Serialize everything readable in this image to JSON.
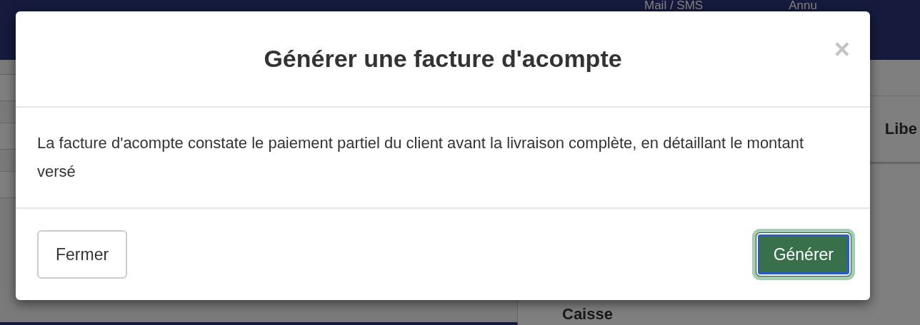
{
  "navbar": {
    "items": [
      "Mail / SMS",
      "Annu"
    ]
  },
  "background": {
    "column_header": "Libe",
    "section_label": "Caisse"
  },
  "modal": {
    "title": "Générer une facture d'acompte",
    "close": "×",
    "body": "La facture d'acompte constate le paiement partiel du client avant la livraison complète, en détaillant le montant versé",
    "buttons": [
      {
        "label": "Fermer",
        "kind": "secondary",
        "focused": false
      },
      {
        "label": "Générer",
        "kind": "primary",
        "focused": true
      }
    ]
  }
}
